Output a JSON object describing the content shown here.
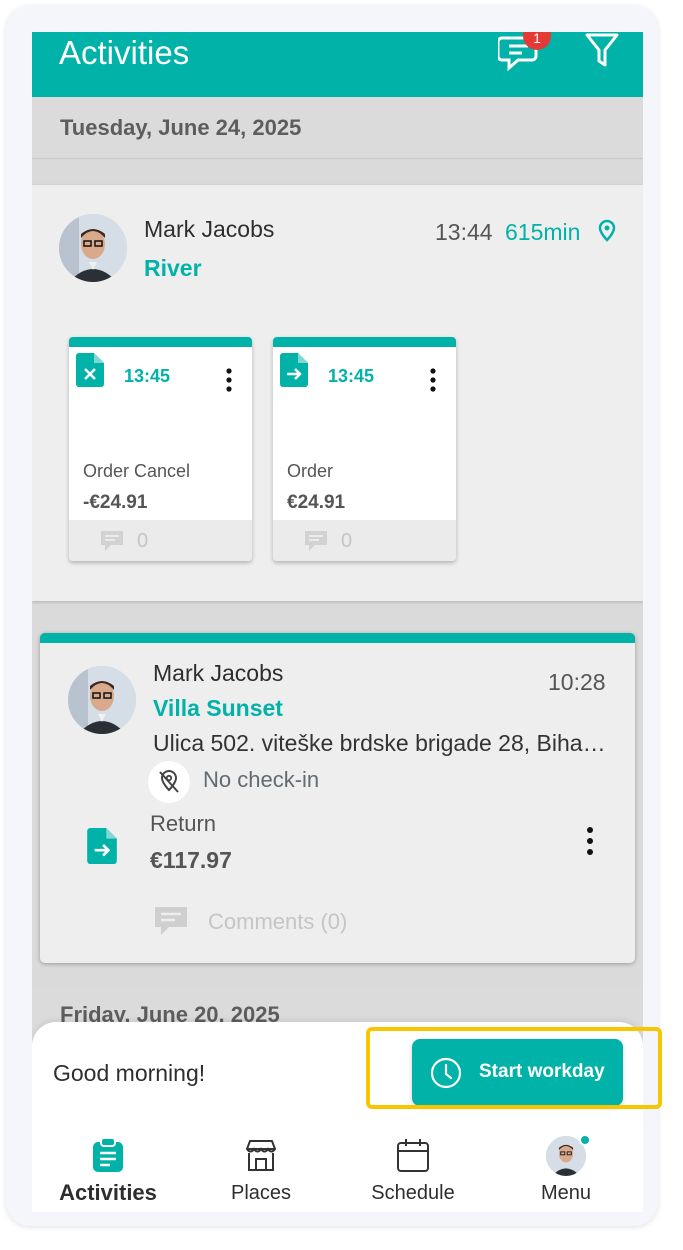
{
  "appbar": {
    "title": "Activities",
    "chat_badge": "1"
  },
  "day1": {
    "date": "Tuesday, June 24, 2025",
    "visit": {
      "user": "Mark Jacobs",
      "place": "River",
      "time": "13:44",
      "duration": "615min",
      "documents": [
        {
          "type": "Order Cancel",
          "time": "13:45",
          "amount": "-€24.91",
          "comments": "0",
          "icon": "document-cancel-icon"
        },
        {
          "type": "Order",
          "time": "13:45",
          "amount": "€24.91",
          "comments": "0",
          "icon": "document-arrow-icon"
        }
      ]
    },
    "visit2": {
      "user": "Mark Jacobs",
      "place": "Villa Sunset",
      "time": "10:28",
      "address": "Ulica 502. viteške brdske brigade 28, Biha…",
      "checkin": "No check-in",
      "doc_type": "Return",
      "doc_amount": "€117.97",
      "comments": "Comments (0)"
    }
  },
  "day2": {
    "date": "Friday, June 20, 2025"
  },
  "sheet": {
    "greeting": "Good morning!",
    "start_button": "Start workday"
  },
  "nav": [
    {
      "label": "Activities",
      "icon": "clipboard-icon",
      "active": true
    },
    {
      "label": "Places",
      "icon": "store-icon"
    },
    {
      "label": "Schedule",
      "icon": "calendar-icon"
    },
    {
      "label": "Menu",
      "icon": "avatar"
    }
  ],
  "colors": {
    "accent": "#00b2a7",
    "highlight": "#f7c600",
    "badge": "#e53935"
  }
}
